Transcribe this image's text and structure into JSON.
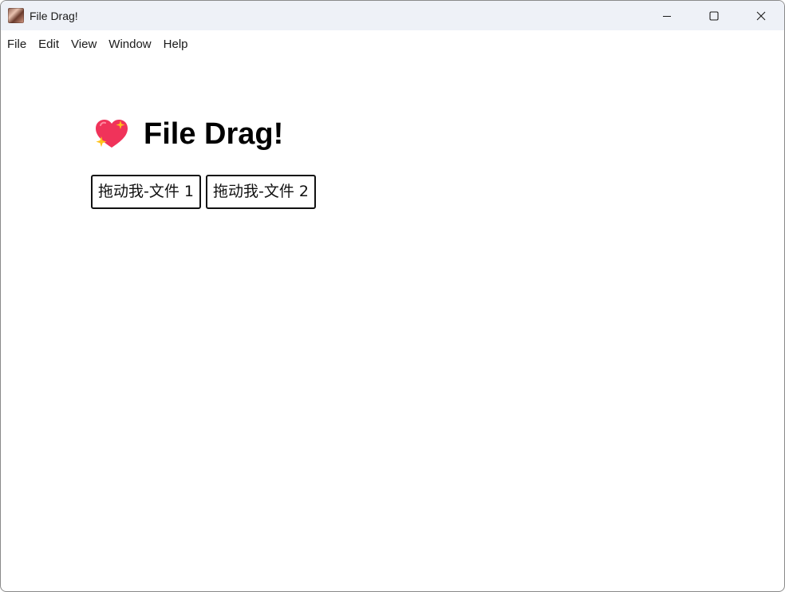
{
  "window": {
    "title": "File Drag!",
    "icon": "app-photo-icon",
    "controls": [
      "minimize-icon",
      "maximize-icon",
      "close-icon"
    ]
  },
  "menubar": {
    "items": [
      {
        "label": "File"
      },
      {
        "label": "Edit"
      },
      {
        "label": "View"
      },
      {
        "label": "Window"
      },
      {
        "label": "Help"
      }
    ]
  },
  "main": {
    "title": "File Drag!",
    "title_icon": "sparkling-heart-icon",
    "buttons": [
      {
        "label": "拖动我-文件 1"
      },
      {
        "label": "拖动我-文件 2"
      }
    ]
  },
  "colors": {
    "heart": "#f0335a",
    "sparkle": "#ffc21a",
    "titlebar": "#eef1f7"
  }
}
